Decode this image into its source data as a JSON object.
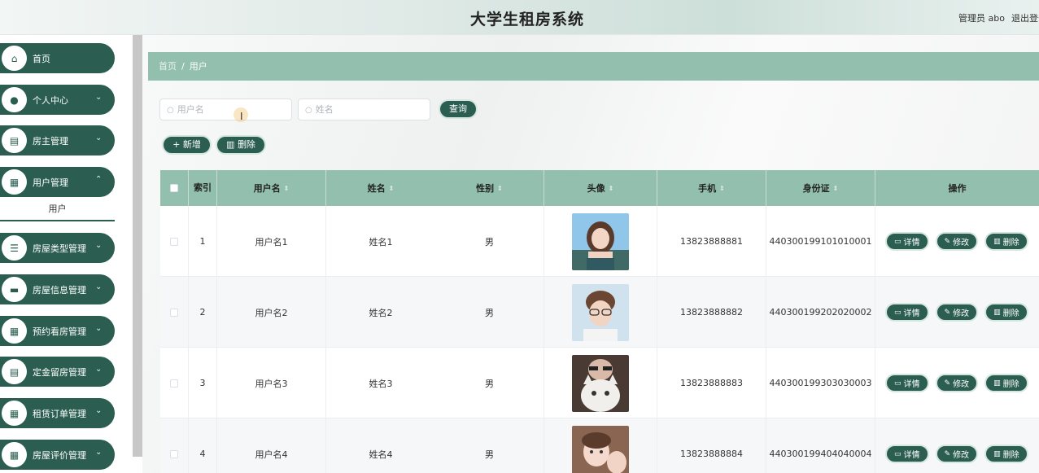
{
  "header": {
    "title": "大学生租房系统",
    "user": "管理员 abo",
    "logout": "退出登录"
  },
  "sidebar": {
    "items": [
      {
        "label": "首页",
        "icon": "home-icon",
        "glyph": "⌂"
      },
      {
        "label": "个人中心",
        "icon": "person-icon",
        "glyph": "●"
      },
      {
        "label": "房主管理",
        "icon": "clipboard-icon",
        "glyph": "▤"
      },
      {
        "label": "用户管理",
        "icon": "grid-icon",
        "glyph": "▦"
      },
      {
        "label": "房屋类型管理",
        "icon": "list-icon",
        "glyph": "☰"
      },
      {
        "label": "房屋信息管理",
        "icon": "briefcase-icon",
        "glyph": "▬"
      },
      {
        "label": "预约看房管理",
        "icon": "grid-icon",
        "glyph": "▦"
      },
      {
        "label": "定金留房管理",
        "icon": "clipboard-icon",
        "glyph": "▤"
      },
      {
        "label": "租赁订单管理",
        "icon": "grid-icon",
        "glyph": "▦"
      },
      {
        "label": "房屋评价管理",
        "icon": "grid-icon",
        "glyph": "▦"
      }
    ],
    "submenu": "用户"
  },
  "breadcrumb": {
    "home": "首页",
    "current": "用户"
  },
  "search": {
    "username_placeholder": "用户名",
    "name_placeholder": "姓名",
    "query_label": "查询"
  },
  "actions": {
    "add_label": "+ 新增",
    "delete_label": "删除"
  },
  "table": {
    "headers": [
      "索引",
      "用户名",
      "姓名",
      "性别",
      "头像",
      "手机",
      "身份证",
      "操作"
    ],
    "rows": [
      {
        "index": "1",
        "username": "用户名1",
        "name": "姓名1",
        "gender": "男",
        "phone": "13823888881",
        "idcard": "440300199101010001"
      },
      {
        "index": "2",
        "username": "用户名2",
        "name": "姓名2",
        "gender": "男",
        "phone": "13823888882",
        "idcard": "440300199202020002"
      },
      {
        "index": "3",
        "username": "用户名3",
        "name": "姓名3",
        "gender": "男",
        "phone": "13823888883",
        "idcard": "440300199303030003"
      },
      {
        "index": "4",
        "username": "用户名4",
        "name": "姓名4",
        "gender": "男",
        "phone": "13823888884",
        "idcard": "440300199404040004"
      }
    ],
    "row_actions": {
      "detail": "详情",
      "edit": "修改",
      "delete": "删除"
    }
  },
  "colors": {
    "primary": "#2b5e50",
    "header_bg": "#93bfae"
  }
}
